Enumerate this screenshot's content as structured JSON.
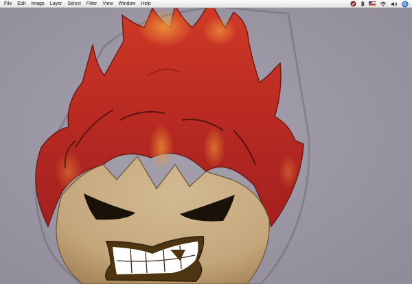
{
  "menubar": {
    "items": [
      {
        "label": "File"
      },
      {
        "label": "Edit"
      },
      {
        "label": "Image"
      },
      {
        "label": "Layer"
      },
      {
        "label": "Select"
      },
      {
        "label": "Filter"
      },
      {
        "label": "View"
      },
      {
        "label": "Window"
      },
      {
        "label": "Help"
      }
    ],
    "status_icons": [
      "script-menu-icon",
      "bluetooth-icon",
      "flag-icon",
      "wifi-icon",
      "volume-icon",
      "spotlight-icon"
    ]
  },
  "canvas": {
    "artwork": "flame-haired-character",
    "colors": {
      "background": "#9a96a3",
      "flame_dark": "#b32424",
      "flame_mid": "#d9402b",
      "flame_light": "#f08a33",
      "skin": "#c9ad84",
      "skin_shadow": "#8d6e45",
      "outline": "#3a2710",
      "teeth": "#ffffff"
    }
  }
}
